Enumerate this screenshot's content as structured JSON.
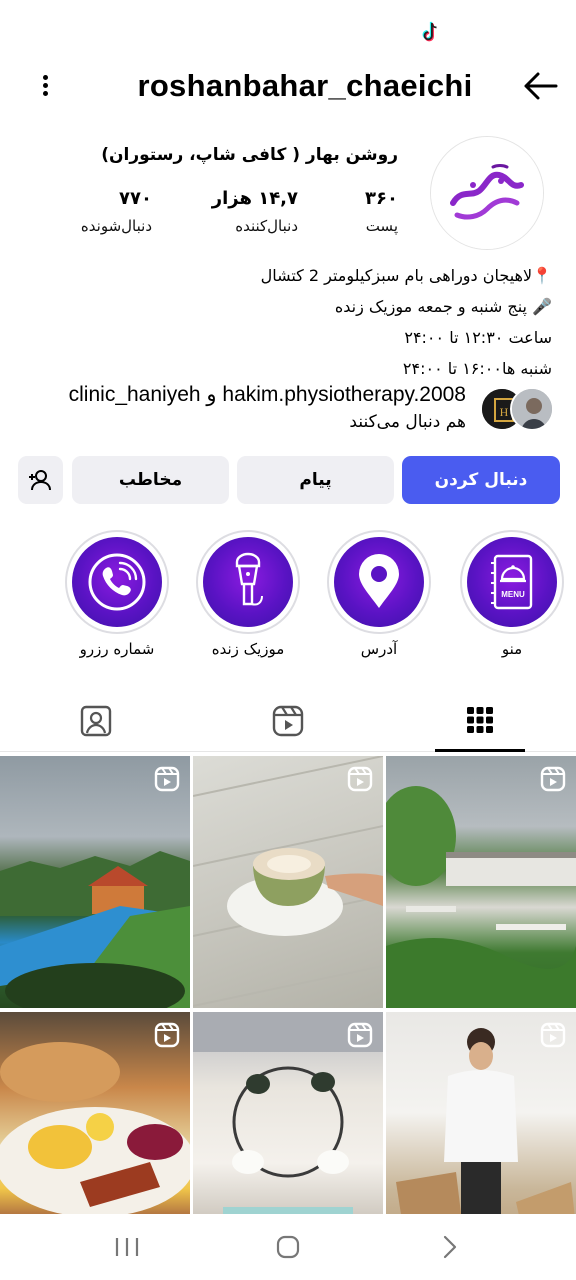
{
  "app": "Instagram",
  "header": {
    "username": "roshanbahar_chaeichi"
  },
  "profile": {
    "display_name": "روشن بهار ( کافی شاپ، رستوران)",
    "avatar_logo_text": "روشن بهار",
    "stats": {
      "posts": {
        "value": "۳۶۰",
        "label": "پست"
      },
      "followers": {
        "value": "۱۴,۷ هزار",
        "label": "دنبال‌کننده"
      },
      "following": {
        "value": "۷۷۰",
        "label": "دنبال‌شونده"
      }
    },
    "bio": [
      "📍لاهیجان دوراهی بام سبزکیلومتر 2 کتشال",
      "🎤 پنج شنبه و جمعه موزیک زنده",
      "ساعت ۱۲:۳۰ تا ۲۴:۰۰",
      "شنبه ها۱۶:۰۰ تا ۲۴:۰۰"
    ],
    "followed_by": {
      "names": "clinic_haniyeh و hakim.physiotherapy.2008",
      "suffix": "هم دنبال می‌کنند"
    }
  },
  "actions": {
    "follow": "دنبال کردن",
    "message": "پیام",
    "contact": "مخاطب"
  },
  "highlights": [
    {
      "label": "منو",
      "icon": "menu-book-icon"
    },
    {
      "label": "آدرس",
      "icon": "location-pin-icon"
    },
    {
      "label": "موزیک زنده",
      "icon": "microphone-icon"
    },
    {
      "label": "شماره رزرو",
      "icon": "phone-call-icon"
    }
  ],
  "tabs": [
    {
      "name": "grid",
      "icon": "grid-icon",
      "active": true
    },
    {
      "name": "reels",
      "icon": "reels-icon",
      "active": false
    },
    {
      "name": "tagged",
      "icon": "tagged-icon",
      "active": false
    }
  ],
  "colors": {
    "accent": "#4a5cf0",
    "highlight_purple": "#6a16d0",
    "button_gray": "#efeff3"
  }
}
